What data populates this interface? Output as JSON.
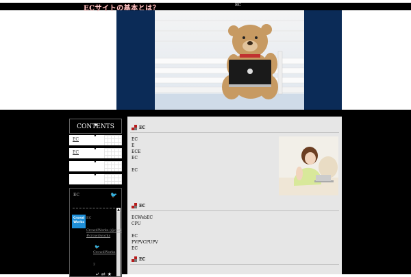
{
  "header": {
    "site_title": "ECサイトの基本とは？",
    "subtitle": "EC"
  },
  "sidebar": {
    "contents_title": "CONTENTS",
    "items": [
      {
        "label": "EC"
      },
      {
        "label": "EC"
      },
      {
        "label": ""
      },
      {
        "label": ""
      }
    ],
    "twitter_widget": {
      "header": "EC",
      "logo_text": "Crowd Works",
      "lines": [
        "EC",
        "CrowdWorks (@cwfl",
        "#crowdworks"
      ],
      "link_text": "CrowdWorks",
      "count": "2"
    }
  },
  "main": {
    "sections": [
      {
        "title": "EC",
        "lines": [
          "EC",
          "E",
          "ECE",
          "EC",
          "",
          "EC"
        ]
      },
      {
        "title": "EC",
        "lines": [
          "ECWebEC",
          "CPU",
          "",
          "EC",
          "PVPVCPUPV",
          "EC"
        ]
      },
      {
        "title": "EC",
        "lines": []
      }
    ]
  },
  "colors": {
    "hero_bg": "#0b2b57",
    "accent_red": "#b81a1a",
    "twitter_blue": "#39a0e5"
  }
}
